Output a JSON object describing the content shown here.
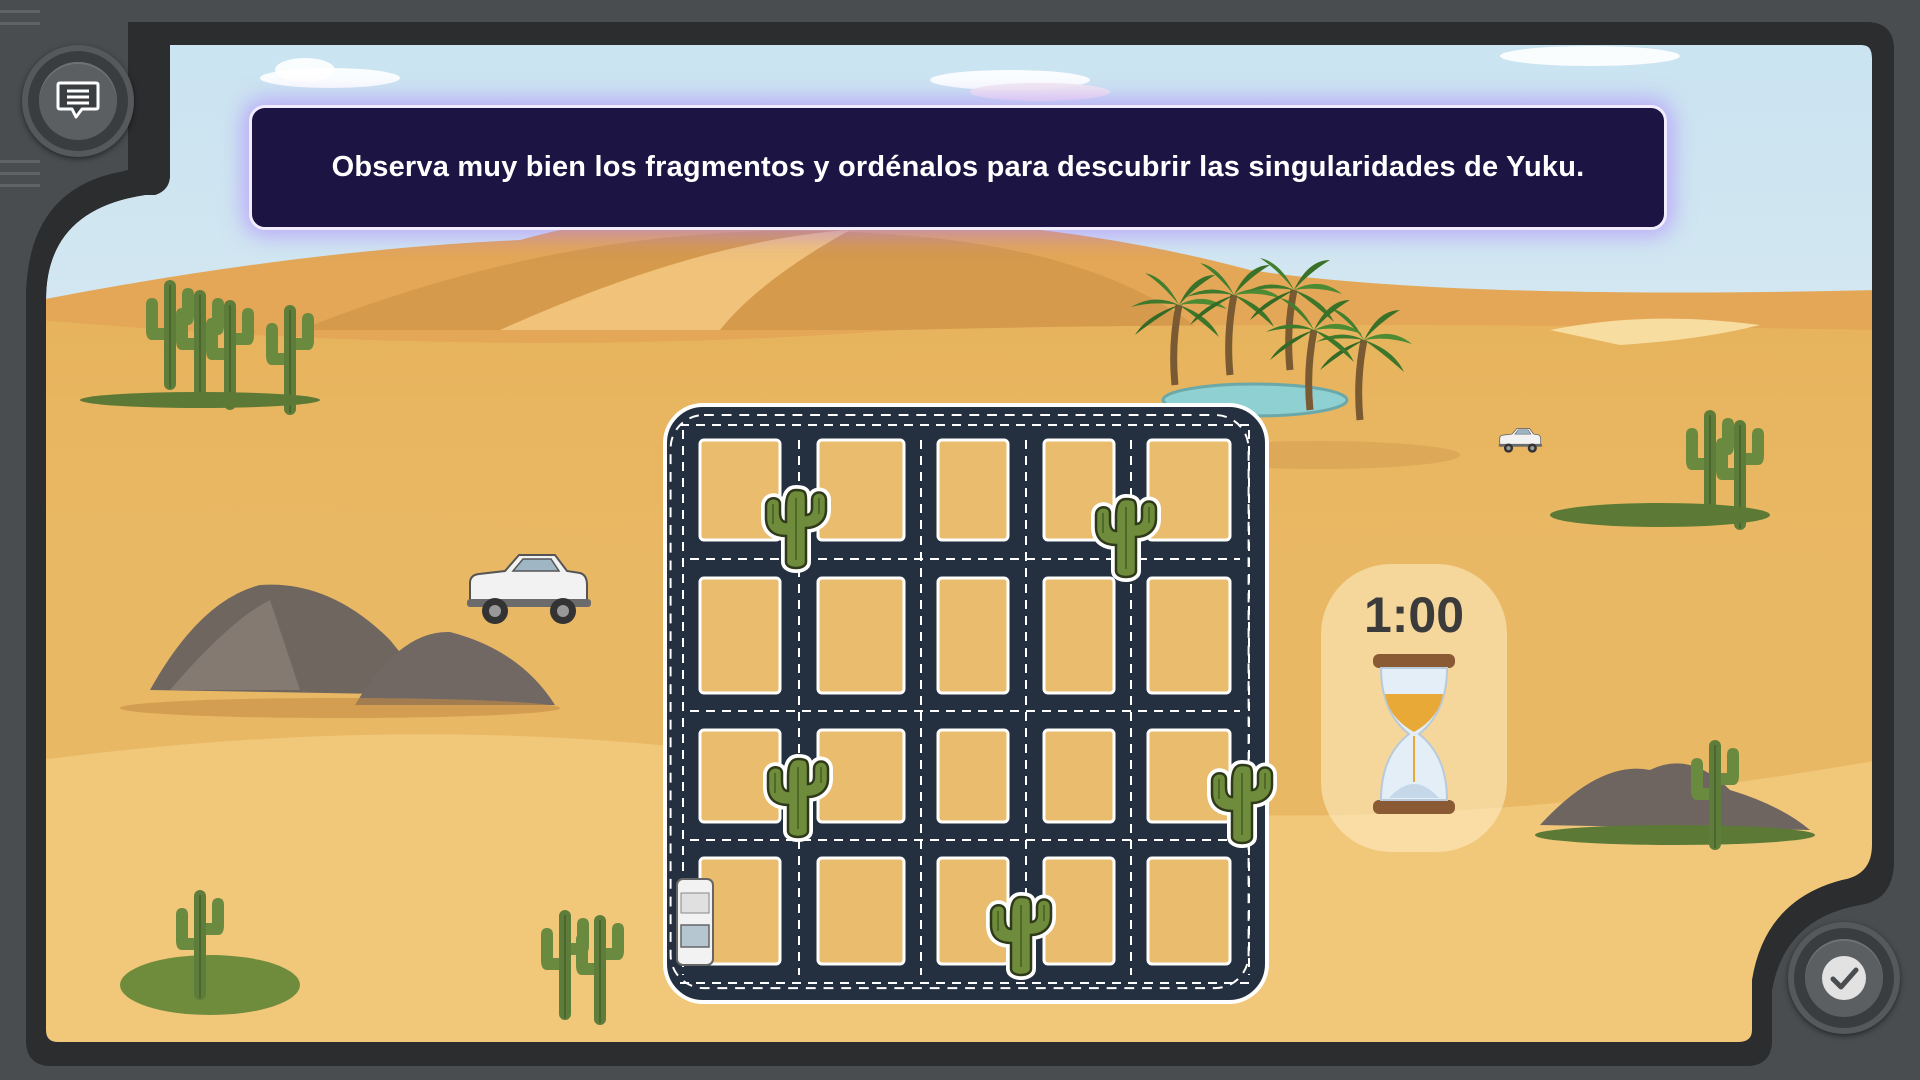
{
  "instruction": {
    "text": "Observa muy bien los fragmentos y ordénalos para descubrir las singularidades de Yuku."
  },
  "timer": {
    "time": "1:00"
  },
  "buttons": {
    "chat_icon": "chat-bubble-icon",
    "check_icon": "checkmark-icon"
  },
  "colors": {
    "sky": "#cfe6f2",
    "sand": "#e8b65c",
    "road": "#243040",
    "panel": "#1c1442",
    "frame": "#4a4d50"
  }
}
